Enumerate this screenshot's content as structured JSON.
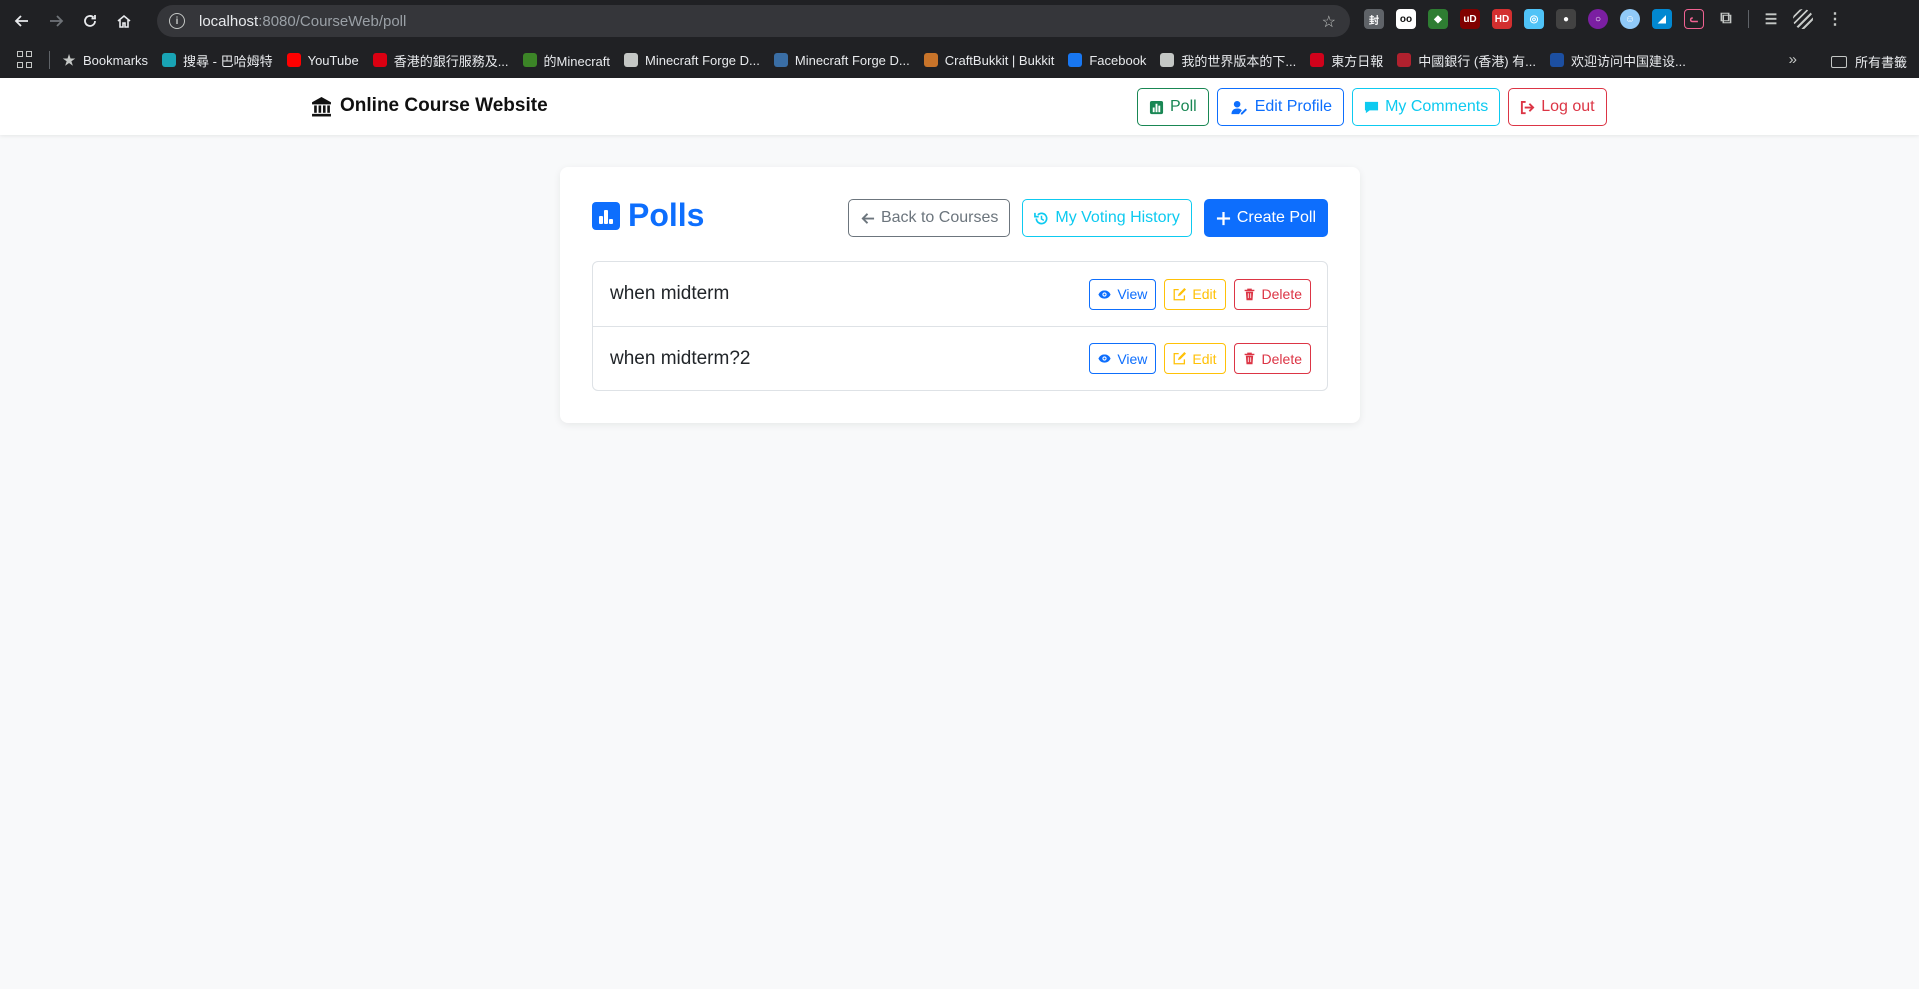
{
  "browser": {
    "url_host": "localhost",
    "url_path": ":8080/CourseWeb/poll",
    "bookmarks": [
      {
        "label": "Bookmarks",
        "icon": "star-icon",
        "color": "#c4c7c5"
      },
      {
        "label": "搜尋 - 巴哈姆特",
        "icon": "bahamut-icon",
        "color": "#19a4b5"
      },
      {
        "label": "YouTube",
        "icon": "youtube-icon",
        "color": "#ff0000"
      },
      {
        "label": "香港的銀行服務及...",
        "icon": "hsbc-icon",
        "color": "#db0011"
      },
      {
        "label": "的Minecraft",
        "icon": "minecraft-icon",
        "color": "#3c8527"
      },
      {
        "label": "Minecraft Forge D...",
        "icon": "forge-icon",
        "color": "#c4c7c5"
      },
      {
        "label": "Minecraft Forge D...",
        "icon": "forge-icon",
        "color": "#3a6ea5"
      },
      {
        "label": "CraftBukkit | Bukkit",
        "icon": "bukkit-icon",
        "color": "#c8742a"
      },
      {
        "label": "Facebook",
        "icon": "facebook-icon",
        "color": "#1877f2"
      },
      {
        "label": "我的世界版本的下...",
        "icon": "image-icon",
        "color": "#c4c7c5"
      },
      {
        "label": "東方日報",
        "icon": "oriental-daily-icon",
        "color": "#d0021b"
      },
      {
        "label": "中國銀行 (香港) 有...",
        "icon": "boc-icon",
        "color": "#b0212e"
      },
      {
        "label": "欢迎访问中国建设...",
        "icon": "ccb-icon",
        "color": "#1c4fa1"
      }
    ],
    "all_bookmarks_label": "所有書籤"
  },
  "navbar": {
    "brand": "Online Course Website",
    "buttons": {
      "poll": "Poll",
      "edit_profile": "Edit Profile",
      "my_comments": "My Comments",
      "logout": "Log out"
    }
  },
  "main": {
    "title": "Polls",
    "actions": {
      "back": "Back to Courses",
      "history": "My Voting History",
      "create": "Create Poll"
    },
    "polls": [
      {
        "title": "when midterm",
        "view": "View",
        "edit": "Edit",
        "delete": "Delete"
      },
      {
        "title": "when midterm?2",
        "view": "View",
        "edit": "Edit",
        "delete": "Delete"
      }
    ]
  }
}
